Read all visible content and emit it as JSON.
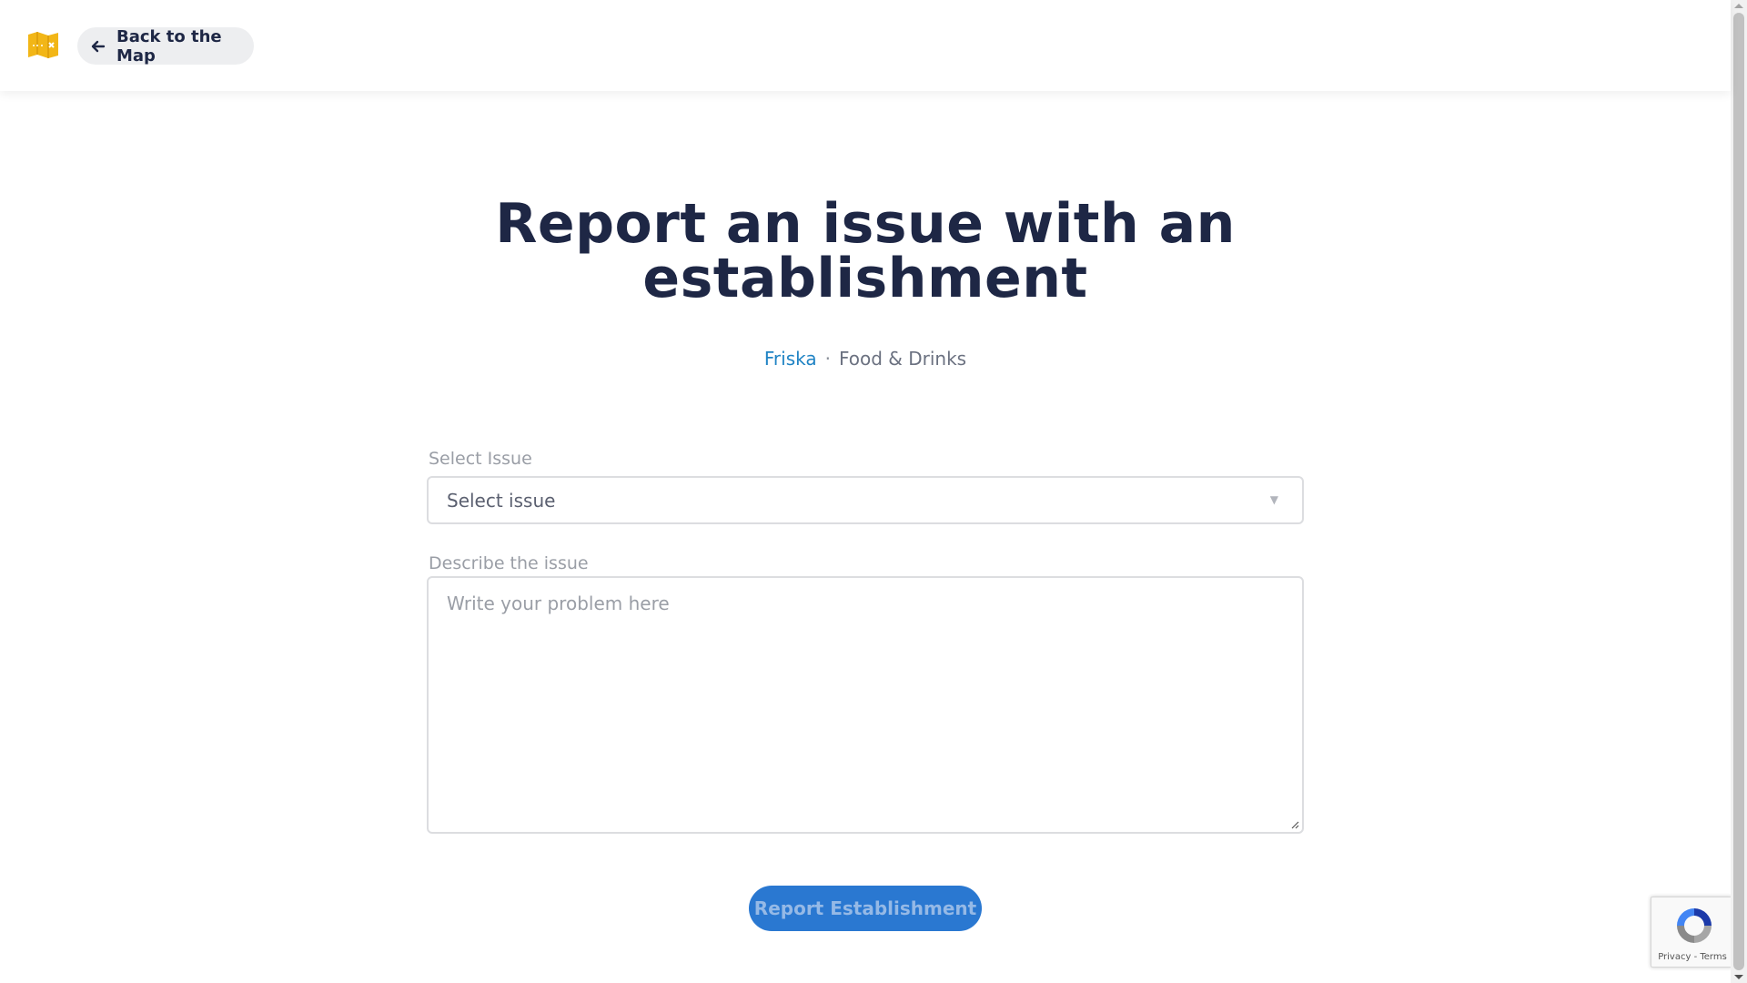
{
  "header": {
    "logo_icon": "map-logo-icon",
    "back_button_icon": "arrow-left-icon",
    "back_button_label": "Back to the Map"
  },
  "hero": {
    "title_line1": "Report an issue with an",
    "title_line2": "establishment",
    "venue_name": "Friska",
    "separator": "·",
    "category": "Food & Drinks"
  },
  "form": {
    "issue_label": "Select Issue",
    "issue_select_value": "Select issue",
    "description_label": "Describe the issue",
    "description_placeholder": "Write your problem here",
    "submit_label": "Report Establishment"
  },
  "recaptcha": {
    "links": "Privacy - Terms"
  },
  "colors": {
    "title": "#1e2745",
    "link": "#1f83c4",
    "button": "#2a78d1",
    "logo": "#f2b617"
  }
}
